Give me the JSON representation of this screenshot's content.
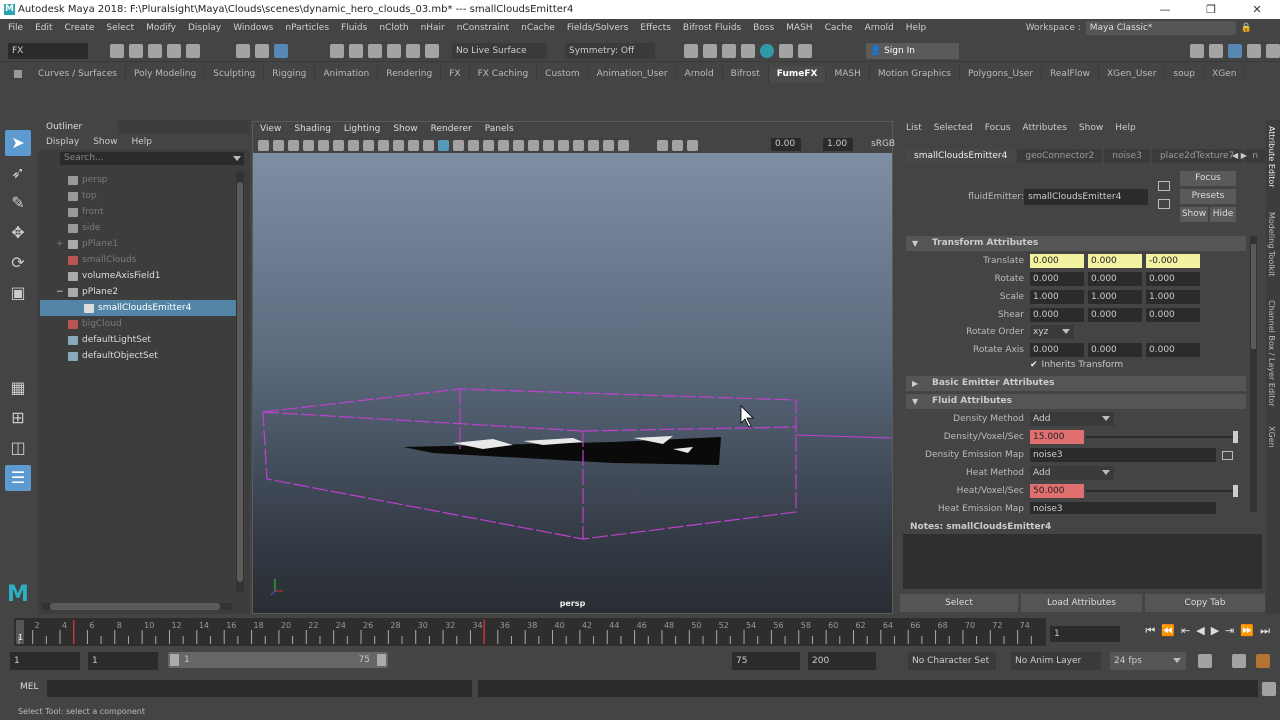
{
  "window": {
    "title": "Autodesk Maya 2018: F:\\Pluralsight\\Maya\\Clouds\\scenes\\dynamic_hero_clouds_03.mb*  ---  smallCloudsEmitter4",
    "controls": [
      "—",
      "❐",
      "✕"
    ]
  },
  "menubar": [
    "File",
    "Edit",
    "Create",
    "Select",
    "Modify",
    "Display",
    "Windows",
    "nParticles",
    "Fluids",
    "nCloth",
    "nHair",
    "nConstraint",
    "nCache",
    "Fields/Solvers",
    "Effects",
    "Bifrost Fluids",
    "Boss",
    "MASH",
    "Cache",
    "Arnold",
    "Help"
  ],
  "workspace": {
    "label": "Workspace :",
    "value": "Maya Classic*"
  },
  "statusline": {
    "menuset": "FX",
    "live_surface": "No Live Surface",
    "symmetry": "Symmetry: Off",
    "sign_in": "Sign In"
  },
  "shelf_tabs": [
    "Curves / Surfaces",
    "Poly Modeling",
    "Sculpting",
    "Rigging",
    "Animation",
    "Rendering",
    "FX",
    "FX Caching",
    "Custom",
    "Animation_User",
    "Arnold",
    "Bifrost",
    "FumeFX",
    "MASH",
    "Motion Graphics",
    "Polygons_User",
    "RealFlow",
    "XGen_User",
    "soup",
    "XGen"
  ],
  "active_shelf": "FumeFX",
  "outliner": {
    "title": "Outliner",
    "menu": [
      "Display",
      "Show",
      "Help"
    ],
    "search_placeholder": "Search...",
    "items": [
      {
        "label": "persp",
        "icon": "camera-icon",
        "dim": true
      },
      {
        "label": "top",
        "icon": "camera-icon",
        "dim": true
      },
      {
        "label": "front",
        "icon": "camera-icon",
        "dim": true
      },
      {
        "label": "side",
        "icon": "camera-icon",
        "dim": true
      },
      {
        "label": "pPlane1",
        "icon": "transform-icon",
        "dim": true,
        "expander": "+"
      },
      {
        "label": "smallClouds",
        "icon": "fluid-container-icon",
        "dim": true
      },
      {
        "label": "volumeAxisField1",
        "icon": "field-icon",
        "dim": false
      },
      {
        "label": "pPlane2",
        "icon": "transform-icon",
        "dim": false,
        "expander": "−"
      },
      {
        "label": "smallCloudsEmitter4",
        "icon": "emitter-icon",
        "dim": false,
        "selected": true,
        "child": true
      },
      {
        "label": "bigCloud",
        "icon": "fluid-container-icon",
        "dim": true
      },
      {
        "label": "defaultLightSet",
        "icon": "set-icon",
        "dim": false
      },
      {
        "label": "defaultObjectSet",
        "icon": "set-icon",
        "dim": false
      }
    ]
  },
  "viewport": {
    "menu": [
      "View",
      "Shading",
      "Lighting",
      "Show",
      "Renderer",
      "Panels"
    ],
    "exposure": "0.00",
    "gamma": "1.00",
    "colorspace": "sRGB",
    "camera_label": "persp"
  },
  "attribute_editor": {
    "menu": [
      "List",
      "Selected",
      "Focus",
      "Attributes",
      "Show",
      "Help"
    ],
    "tabs": [
      "smallCloudsEmitter4",
      "geoConnector2",
      "noise3",
      "place2dTexture7",
      "n"
    ],
    "node_type_label": "fluidEmitter:",
    "node_name": "smallCloudsEmitter4",
    "buttons": {
      "focus": "Focus",
      "presets": "Presets",
      "show": "Show",
      "hide": "Hide"
    },
    "sections": {
      "transform": "Transform Attributes",
      "basic_emitter": "Basic Emitter Attributes",
      "fluid": "Fluid Attributes"
    },
    "transform": [
      {
        "label": "Translate",
        "values": [
          "0.000",
          "0.000",
          "-0.000"
        ],
        "highlight": "yellow"
      },
      {
        "label": "Rotate",
        "values": [
          "0.000",
          "0.000",
          "0.000"
        ]
      },
      {
        "label": "Scale",
        "values": [
          "1.000",
          "1.000",
          "1.000"
        ]
      },
      {
        "label": "Shear",
        "values": [
          "0.000",
          "0.000",
          "0.000"
        ]
      }
    ],
    "rotate_order": {
      "label": "Rotate Order",
      "value": "xyz"
    },
    "rotate_axis": {
      "label": "Rotate Axis",
      "values": [
        "0.000",
        "0.000",
        "0.000"
      ]
    },
    "inherits_transform": {
      "label": "Inherits Transform",
      "checked": true
    },
    "fluid": {
      "density_method": {
        "label": "Density Method",
        "value": "Add"
      },
      "density_rate": {
        "label": "Density/Voxel/Sec",
        "value": "15.000"
      },
      "density_map": {
        "label": "Density Emission Map",
        "value": "noise3"
      },
      "heat_method": {
        "label": "Heat Method",
        "value": "Add"
      },
      "heat_rate": {
        "label": "Heat/Voxel/Sec",
        "value": "50.000"
      },
      "heat_map": {
        "label": "Heat Emission Map",
        "value": "noise3"
      }
    },
    "notes_label": "Notes:  smallCloudsEmitter4",
    "bottom_buttons": [
      "Select",
      "Load Attributes",
      "Copy Tab"
    ]
  },
  "side_tabs": [
    "Attribute Editor",
    "Modeling Toolkit",
    "Channel Box / Layer Editor",
    "XGen"
  ],
  "timeline": {
    "ticks": [
      "2",
      "4",
      "6",
      "8",
      "10",
      "12",
      "14",
      "16",
      "18",
      "20",
      "22",
      "24",
      "26",
      "28",
      "30",
      "32",
      "34",
      "36",
      "38",
      "40",
      "42",
      "44",
      "46",
      "48",
      "50",
      "52",
      "54",
      "56",
      "58",
      "60",
      "62",
      "64",
      "66",
      "68",
      "70",
      "72",
      "74"
    ],
    "current_frame": "1",
    "key_frames": [
      5,
      35
    ],
    "current_field": "1"
  },
  "range": {
    "start": "1",
    "playback_start": "1",
    "slider_start": "1",
    "slider_end": "75",
    "playback_end": "75",
    "end": "200",
    "character_set": "No Character Set",
    "anim_layer": "No Anim Layer",
    "fps": "24 fps"
  },
  "mel": {
    "label": "MEL"
  },
  "help_line": "Select Tool: select a component",
  "colors": {
    "selection": "#5285a6",
    "emitter_box": "#c040d0",
    "keyed_field": "#f2f2a0",
    "red_field": "#e07070"
  }
}
